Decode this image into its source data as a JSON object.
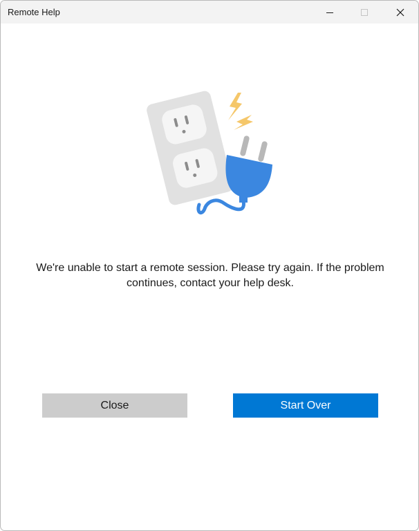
{
  "window": {
    "title": "Remote Help",
    "controls": {
      "minimize_icon": "minimize-icon",
      "maximize_icon": "maximize-icon",
      "close_icon": "close-icon"
    }
  },
  "illustration": {
    "icon": "unplugged-outlet-icon"
  },
  "message": {
    "line1": "We're unable to start a remote session. Please try again. If the problem",
    "line2": "continues, contact your help desk."
  },
  "buttons": {
    "close_label": "Close",
    "start_over_label": "Start Over"
  },
  "colors": {
    "titlebar_bg": "#f3f3f3",
    "secondary_button_bg": "#cccccc",
    "primary_button_bg": "#0078d4",
    "plug_blue": "#3b87e0",
    "outlet_gray": "#e1e1e1",
    "spark_yellow": "#f5c76a"
  }
}
